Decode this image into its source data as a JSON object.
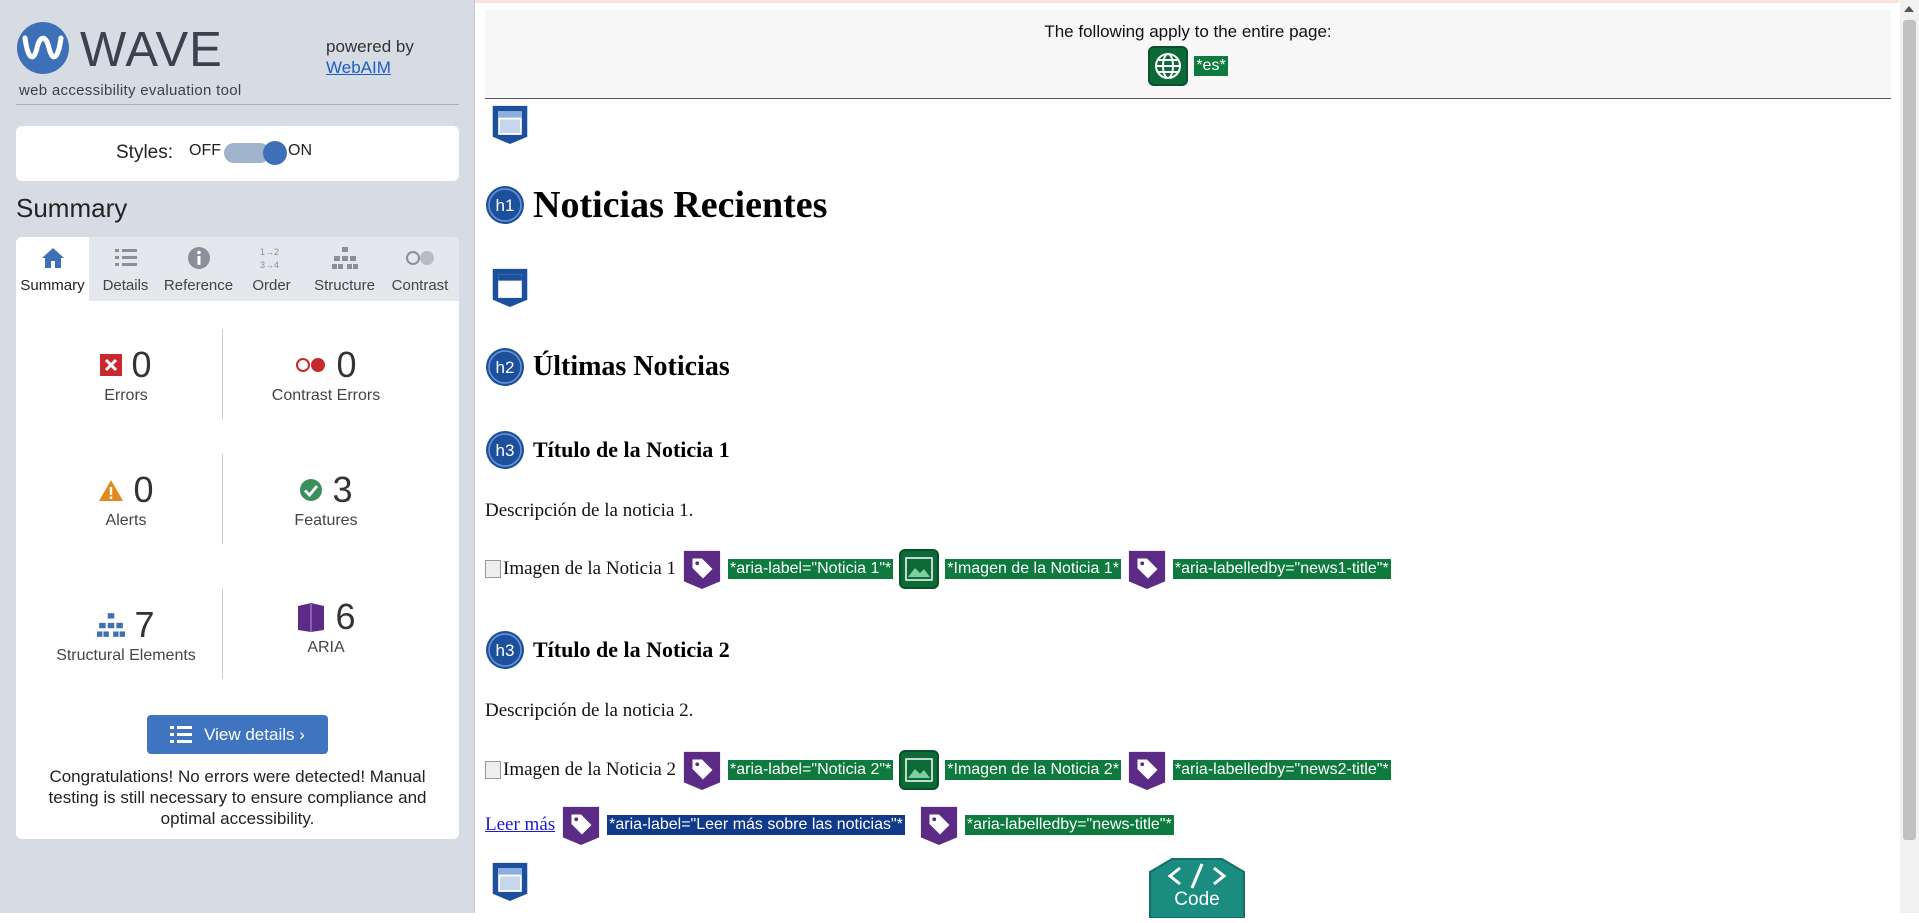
{
  "sidebar": {
    "logo_word": "WAVE",
    "tagline": "web accessibility evaluation tool",
    "powered_by": "powered by",
    "webaim_link": "WebAIM",
    "styles_label": "Styles:",
    "styles_off": "OFF",
    "styles_on": "ON",
    "styles_enabled": true,
    "summary_heading": "Summary",
    "tabs": [
      {
        "label": "Summary",
        "icon": "home-icon",
        "active": true
      },
      {
        "label": "Details",
        "icon": "list-icon",
        "active": false
      },
      {
        "label": "Reference",
        "icon": "info-icon",
        "active": false
      },
      {
        "label": "Order",
        "icon": "order-icon",
        "active": false
      },
      {
        "label": "Structure",
        "icon": "structure-icon",
        "active": false
      },
      {
        "label": "Contrast",
        "icon": "contrast-icon",
        "active": false
      }
    ],
    "stats": {
      "errors": {
        "value": "0",
        "label": "Errors"
      },
      "contrast_errors": {
        "value": "0",
        "label": "Contrast Errors"
      },
      "alerts": {
        "value": "0",
        "label": "Alerts"
      },
      "features": {
        "value": "3",
        "label": "Features"
      },
      "structural": {
        "value": "7",
        "label": "Structural Elements"
      },
      "aria": {
        "value": "6",
        "label": "ARIA"
      }
    },
    "view_details": "View details ›",
    "congrats": "Congratulations! No errors were detected! Manual testing is still necessary to ensure compliance and optimal accessibility."
  },
  "main": {
    "banner_text": "The following apply to the entire page:",
    "lang_badge": "*es*",
    "h1": "Noticias Recientes",
    "h2": "Últimas Noticias",
    "news1": {
      "h3": "Título de la Noticia 1",
      "desc": "Descripción de la noticia 1.",
      "img_alt": "Imagen de la Noticia 1",
      "aria_label": "*aria-label=\"Noticia 1\"*",
      "alt_badge": "*Imagen de la Noticia 1*",
      "labelledby": "*aria-labelledby=\"news1-title\"*"
    },
    "news2": {
      "h3": "Título de la Noticia 2",
      "desc": "Descripción de la noticia 2.",
      "img_alt": "Imagen de la Noticia 2",
      "aria_label": "*aria-label=\"Noticia 2\"*",
      "alt_badge": "*Imagen de la Noticia 2*",
      "labelledby": "*aria-labelledby=\"news2-title\"*"
    },
    "link_text": "Leer más",
    "link_aria_label": "*aria-label=\"Leer más sobre las noticias\"*",
    "link_labelledby": "*aria-labelledby=\"news-title\"*",
    "code_tab": "Code"
  },
  "colors": {
    "accent_blue": "#3f74c0",
    "feature_green": "#0e7a3e",
    "aria_purple": "#5b2b86",
    "heading_blue": "#1c4f9c"
  }
}
